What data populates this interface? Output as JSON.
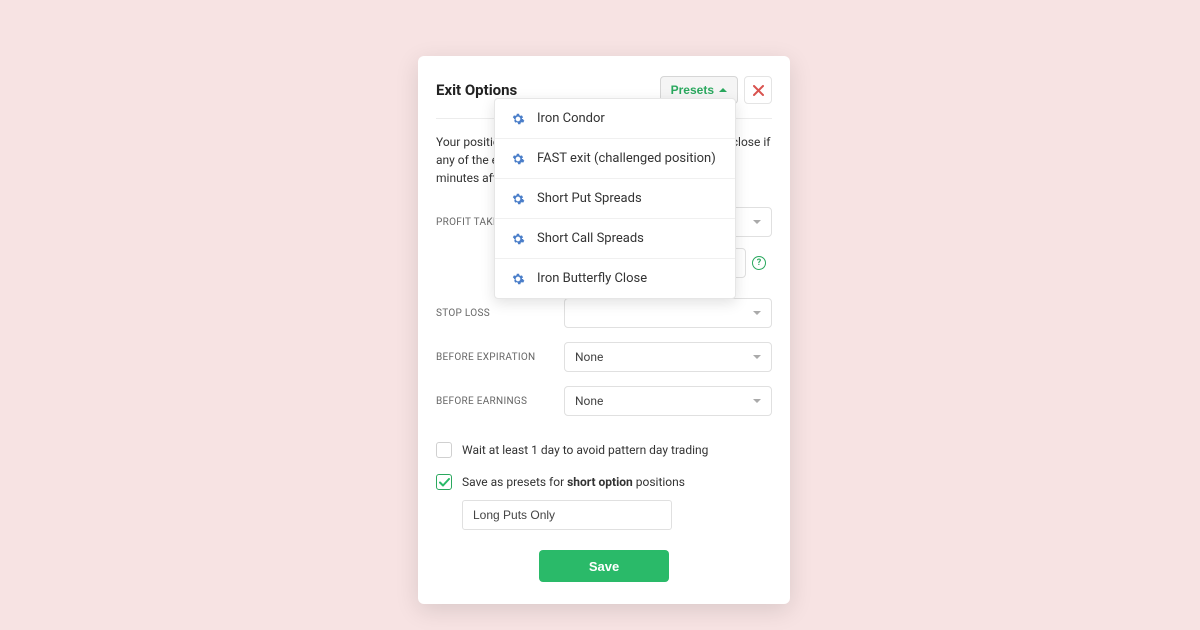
{
  "modal": {
    "title": "Exit Options",
    "presets_button_label": "Presets",
    "description": "Your position will be monitored and the bot attempts to close if any of the exit options trigger. Closings are triggered 30 minutes after market open.",
    "fields": {
      "profit_taking": {
        "label": "PROFIT TAKING",
        "value": ""
      },
      "profit_taking_extra": {
        "value": ""
      },
      "stop_loss": {
        "label": "STOP LOSS",
        "value": ""
      },
      "before_expiration": {
        "label": "BEFORE EXPIRATION",
        "value": "None"
      },
      "before_earnings": {
        "label": "BEFORE EARNINGS",
        "value": "None"
      }
    },
    "checkboxes": {
      "pattern_day": {
        "label": "Wait at least 1 day to avoid pattern day trading",
        "checked": false
      },
      "save_preset_pre": "Save as presets for",
      "save_preset_bold": "short option",
      "save_preset_post": "positions"
    },
    "preset_name_value": "Long Puts Only",
    "save_button": "Save"
  },
  "dropdown": {
    "items": [
      "Iron Condor",
      "FAST exit (challenged position)",
      "Short Put Spreads",
      "Short Call Spreads",
      "Iron Butterfly Close"
    ]
  },
  "colors": {
    "accent": "#2aba69",
    "icon_blue": "#4a7ec9",
    "close_red": "#d9534f"
  }
}
